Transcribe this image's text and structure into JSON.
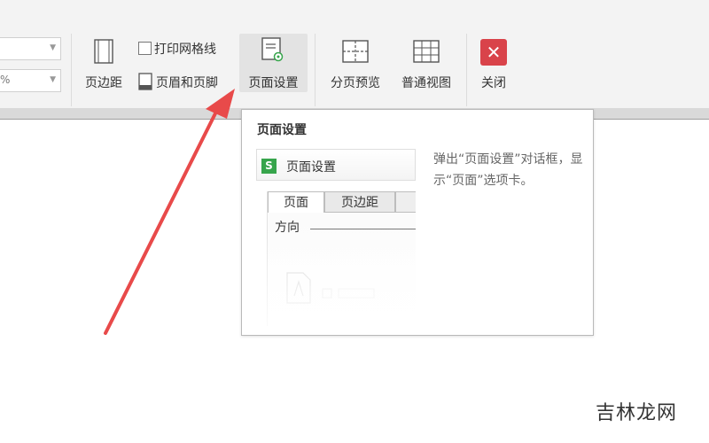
{
  "ribbon": {
    "combo_top_value": "",
    "combo_bottom_value": "%",
    "margins_label": "页边距",
    "print_gridlines_label": "打印网格线",
    "header_footer_label": "页眉和页脚",
    "page_setup_label": "页面设置",
    "page_break_preview_label": "分页预览",
    "normal_view_label": "普通视图",
    "close_label": "关闭",
    "close_glyph": "✕"
  },
  "tooltip": {
    "title": "页面设置",
    "preview": {
      "app_icon_letter": "S",
      "dialog_title": "页面设置",
      "tab_page": "页面",
      "tab_margins": "页边距",
      "orientation_label": "方向"
    },
    "description": "弹出“页面设置”对话框，显示“页面”选项卡。"
  },
  "watermark": "吉林龙网",
  "colors": {
    "accent_red": "#d9434a",
    "app_green": "#37a54c",
    "annotation_arrow": "#e84a4a"
  }
}
